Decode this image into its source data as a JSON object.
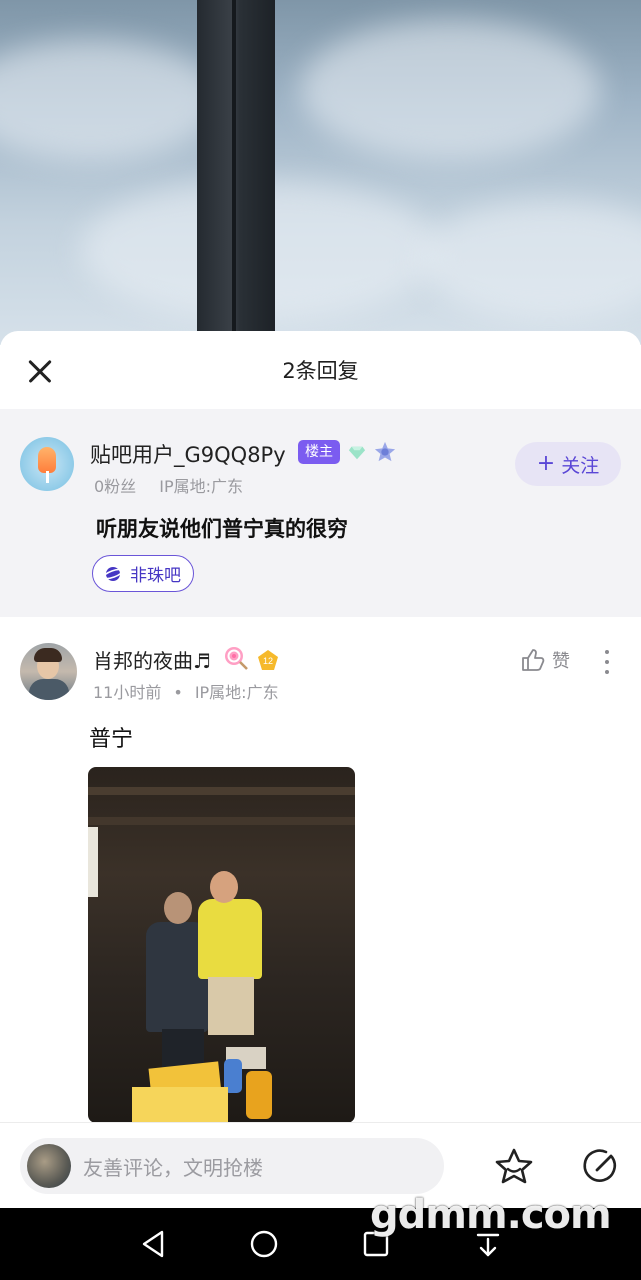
{
  "sheet": {
    "title": "2条回复"
  },
  "op": {
    "username": "贴吧用户_G9QQ8Py",
    "owner_badge": "楼主",
    "fans": "0粉丝",
    "ip": "IP属地:广东",
    "follow_label": "关注",
    "post_text": "听朋友说他们普宁真的很穷",
    "forum_tag": "非珠吧"
  },
  "reply": {
    "username": "肖邦的夜曲♬",
    "level": "12",
    "time": "11小时前",
    "ip": "IP属地:广东",
    "like_label": "赞",
    "text": "普宁"
  },
  "comment_bar": {
    "placeholder": "友善评论，文明抢楼"
  },
  "watermark": "gdmm.com",
  "colors": {
    "accent": "#7b5cf0",
    "follow_bg": "#e7e4f5",
    "card_bg": "#f3f3f6"
  }
}
